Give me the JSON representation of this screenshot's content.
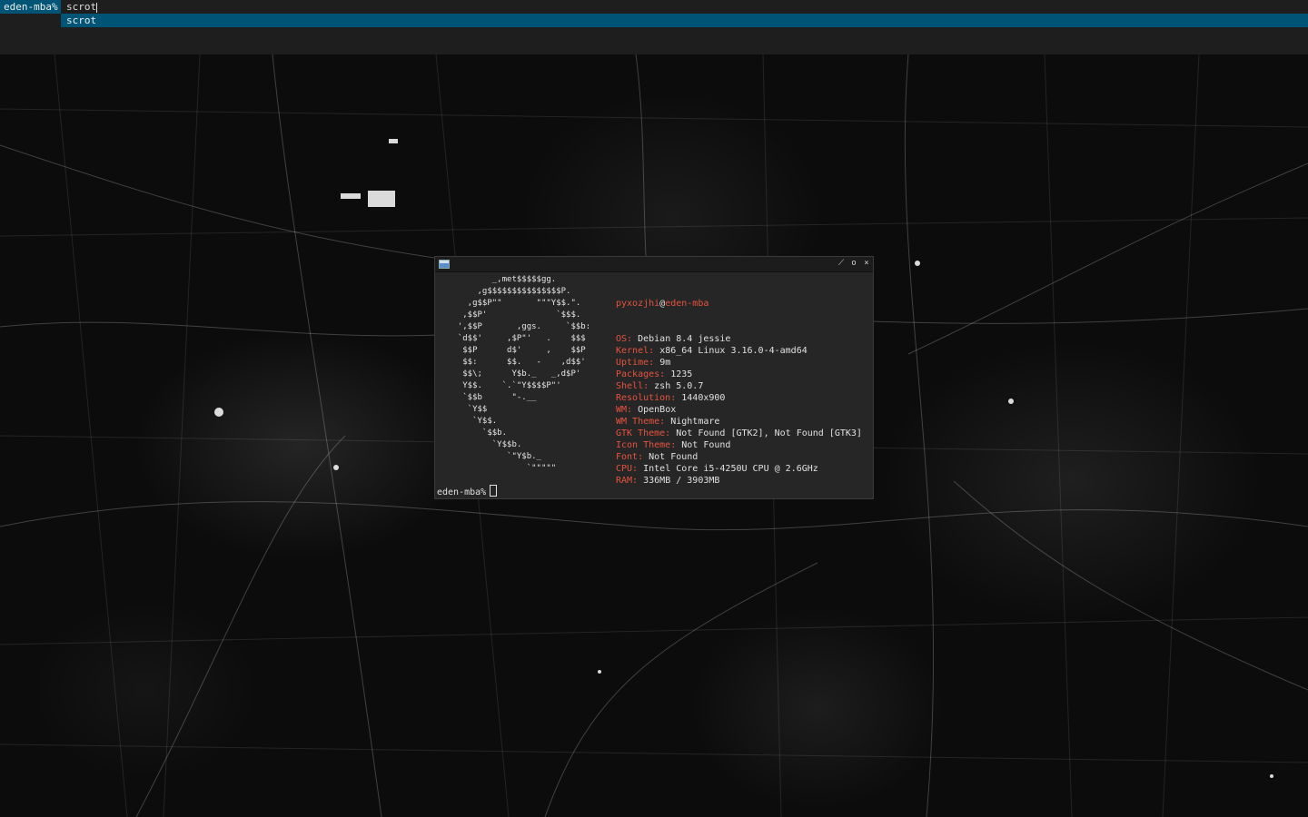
{
  "launcher": {
    "prompt": "eden-mba%",
    "query": "scrot",
    "suggestions": [
      "scrot"
    ]
  },
  "terminal": {
    "logo_lines": [
      "         _,met$$$$$gg.",
      "      ,g$$$$$$$$$$$$$$$P.",
      "    ,g$$P\"\"       \"\"\"Y$$.\".",
      "   ,$$P'              `$$$.",
      "  ',$$P       ,ggs.     `$$b:",
      "  `d$$'     ,$P\"'   .    $$$",
      "   $$P      d$'     ,    $$P",
      "   $$:      $$.   -    ,d$$'",
      "   $$\\;      Y$b._   _,d$P'",
      "   Y$$.    `.`\"Y$$$$P\"'",
      "   `$$b      \"-.__",
      "    `Y$$",
      "     `Y$$.",
      "       `$$b.",
      "         `Y$$b.",
      "            `\"Y$b._",
      "                `\"\"\"\"\""
    ],
    "user": "pyxozjhi",
    "at": "@",
    "host": "eden-mba",
    "info": [
      {
        "key": "OS:",
        "value": "Debian 8.4 jessie"
      },
      {
        "key": "Kernel:",
        "value": "x86_64 Linux 3.16.0-4-amd64"
      },
      {
        "key": "Uptime:",
        "value": "9m"
      },
      {
        "key": "Packages:",
        "value": "1235"
      },
      {
        "key": "Shell:",
        "value": "zsh 5.0.7"
      },
      {
        "key": "Resolution:",
        "value": "1440x900"
      },
      {
        "key": "WM:",
        "value": "OpenBox"
      },
      {
        "key": "WM Theme:",
        "value": "Nightmare"
      },
      {
        "key": "GTK Theme:",
        "value": "Not Found [GTK2], Not Found [GTK3]"
      },
      {
        "key": "Icon Theme:",
        "value": "Not Found"
      },
      {
        "key": "Font:",
        "value": "Not Found"
      },
      {
        "key": "CPU:",
        "value": "Intel Core i5-4250U CPU @ 2.6GHz"
      },
      {
        "key": "RAM:",
        "value": "336MB / 3903MB"
      }
    ],
    "prompt": "eden-mba%",
    "buttons": {
      "iconify": "⟋",
      "maximize": "o",
      "close": "×"
    }
  },
  "colors": {
    "accent": "#005577",
    "key_red": "#e5533f",
    "terminal_bg": "#262626",
    "launcher_bg": "#1e1e1e"
  }
}
